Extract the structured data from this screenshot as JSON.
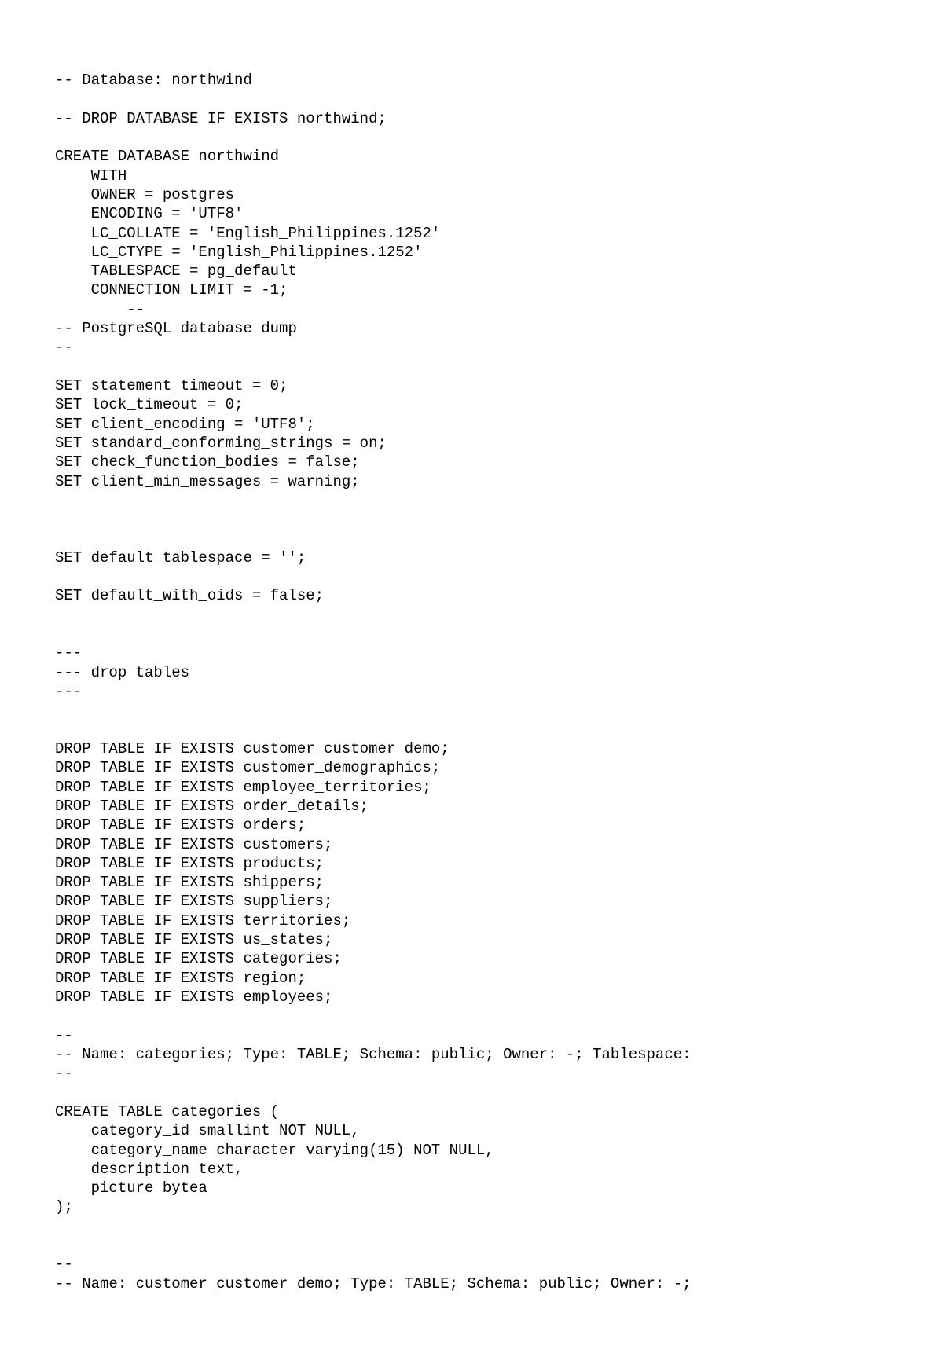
{
  "code_lines": [
    "-- Database: northwind",
    "",
    "-- DROP DATABASE IF EXISTS northwind;",
    "",
    "CREATE DATABASE northwind",
    "    WITH",
    "    OWNER = postgres",
    "    ENCODING = 'UTF8'",
    "    LC_COLLATE = 'English_Philippines.1252'",
    "    LC_CTYPE = 'English_Philippines.1252'",
    "    TABLESPACE = pg_default",
    "    CONNECTION LIMIT = -1;",
    "        --",
    "-- PostgreSQL database dump",
    "--",
    "",
    "SET statement_timeout = 0;",
    "SET lock_timeout = 0;",
    "SET client_encoding = 'UTF8';",
    "SET standard_conforming_strings = on;",
    "SET check_function_bodies = false;",
    "SET client_min_messages = warning;",
    "",
    "",
    "",
    "SET default_tablespace = '';",
    "",
    "SET default_with_oids = false;",
    "",
    "",
    "---",
    "--- drop tables",
    "---",
    "",
    "",
    "DROP TABLE IF EXISTS customer_customer_demo;",
    "DROP TABLE IF EXISTS customer_demographics;",
    "DROP TABLE IF EXISTS employee_territories;",
    "DROP TABLE IF EXISTS order_details;",
    "DROP TABLE IF EXISTS orders;",
    "DROP TABLE IF EXISTS customers;",
    "DROP TABLE IF EXISTS products;",
    "DROP TABLE IF EXISTS shippers;",
    "DROP TABLE IF EXISTS suppliers;",
    "DROP TABLE IF EXISTS territories;",
    "DROP TABLE IF EXISTS us_states;",
    "DROP TABLE IF EXISTS categories;",
    "DROP TABLE IF EXISTS region;",
    "DROP TABLE IF EXISTS employees;",
    "",
    "--",
    "-- Name: categories; Type: TABLE; Schema: public; Owner: -; Tablespace:",
    "--",
    "",
    "CREATE TABLE categories (",
    "    category_id smallint NOT NULL,",
    "    category_name character varying(15) NOT NULL,",
    "    description text,",
    "    picture bytea",
    ");",
    "",
    "",
    "--",
    "-- Name: customer_customer_demo; Type: TABLE; Schema: public; Owner: -;"
  ]
}
